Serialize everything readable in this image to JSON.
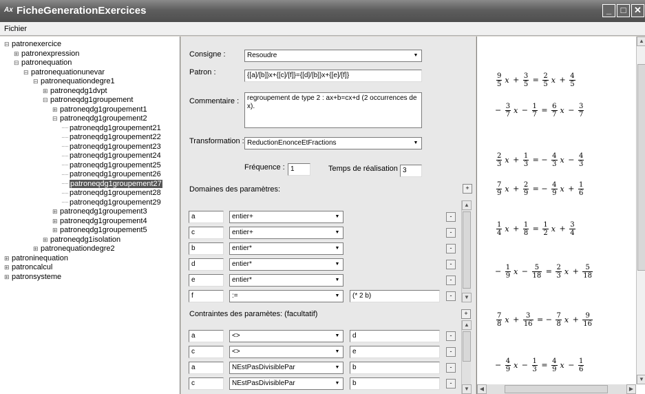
{
  "window": {
    "title": "FicheGenerationExercices",
    "icon": "app-icon",
    "buttons": [
      "minimize-icon",
      "maximize-icon",
      "close-icon"
    ]
  },
  "menu": [
    "Fichier"
  ],
  "tree": [
    {
      "label": "patronexercice",
      "level": 0,
      "exp": "minus"
    },
    {
      "label": "patronexpression",
      "level": 1,
      "exp": "plus"
    },
    {
      "label": "patronequation",
      "level": 1,
      "exp": "minus"
    },
    {
      "label": "patronequationunevar",
      "level": 2,
      "exp": "minus"
    },
    {
      "label": "patronequationdegre1",
      "level": 3,
      "exp": "minus"
    },
    {
      "label": "patroneqdg1dvpt",
      "level": 4,
      "exp": "plus"
    },
    {
      "label": "patroneqdg1groupement",
      "level": 4,
      "exp": "minus"
    },
    {
      "label": "patroneqdg1groupement1",
      "level": 5,
      "exp": "plus"
    },
    {
      "label": "patroneqdg1groupement2",
      "level": 5,
      "exp": "minus"
    },
    {
      "label": "patroneqdg1groupement21",
      "level": 6,
      "exp": "leaf"
    },
    {
      "label": "patroneqdg1groupement22",
      "level": 6,
      "exp": "leaf"
    },
    {
      "label": "patroneqdg1groupement23",
      "level": 6,
      "exp": "leaf"
    },
    {
      "label": "patroneqdg1groupement24",
      "level": 6,
      "exp": "leaf"
    },
    {
      "label": "patroneqdg1groupement25",
      "level": 6,
      "exp": "leaf"
    },
    {
      "label": "patroneqdg1groupement26",
      "level": 6,
      "exp": "leaf"
    },
    {
      "label": "patroneqdg1groupement27",
      "level": 6,
      "exp": "leaf",
      "selected": true
    },
    {
      "label": "patroneqdg1groupement28",
      "level": 6,
      "exp": "leaf"
    },
    {
      "label": "patroneqdg1groupement29",
      "level": 6,
      "exp": "leaf"
    },
    {
      "label": "patroneqdg1groupement3",
      "level": 5,
      "exp": "plus"
    },
    {
      "label": "patroneqdg1groupement4",
      "level": 5,
      "exp": "plus"
    },
    {
      "label": "patroneqdg1groupement5",
      "level": 5,
      "exp": "plus"
    },
    {
      "label": "patroneqdg1isolation",
      "level": 4,
      "exp": "plus"
    },
    {
      "label": "patronequationdegre2",
      "level": 3,
      "exp": "plus"
    },
    {
      "label": "patroninequation",
      "level": 0,
      "exp": "plus"
    },
    {
      "label": "patroncalcul",
      "level": 0,
      "exp": "plus"
    },
    {
      "label": "patronsysteme",
      "level": 0,
      "exp": "plus"
    }
  ],
  "form": {
    "consigne_label": "Consigne :",
    "consigne_value": "Resoudre",
    "patron_label": "Patron :",
    "patron_value": "{[a]/[b]}x+{[c]/[f]}={[d]/[b]}x+{[e]/[f]}",
    "commentaire_label": "Commentaire :",
    "commentaire_value": "regroupement de type 2 : ax+b=cx+d (2 occurrences de x).",
    "transformation_label": "Transformation :",
    "transformation_value": "ReductionEnonceEtFractions",
    "frequence_label": "Fréquence :",
    "frequence_value": "1",
    "temps_label": "Temps de réalisation :",
    "temps_value": "3",
    "domaines_label": "Domaines des paramètres:",
    "contraintes_label": "Contraintes des paramètes: (facultatif)",
    "add_glyph": "+",
    "remove_glyph": "-",
    "domaines": [
      {
        "name": "a",
        "type": "entier+",
        "expr": ""
      },
      {
        "name": "c",
        "type": "entier+",
        "expr": ""
      },
      {
        "name": "b",
        "type": "entier*",
        "expr": ""
      },
      {
        "name": "d",
        "type": "entier*",
        "expr": ""
      },
      {
        "name": "e",
        "type": "entier*",
        "expr": ""
      },
      {
        "name": "f",
        "type": ":=",
        "expr": "(* 2 b)"
      }
    ],
    "contraintes": [
      {
        "left": "a",
        "op": "<>",
        "right": "d"
      },
      {
        "left": "c",
        "op": "<>",
        "right": "e"
      },
      {
        "left": "a",
        "op": "NEstPasDivisiblePar",
        "right": "b"
      },
      {
        "left": "c",
        "op": "NEstPasDivisiblePar",
        "right": "b"
      }
    ]
  },
  "equations": [
    {
      "html": "<F>9|5</F><i>x</i> + <F>3|5</F> = <F>2|5</F><i>x</i> + <F>4|5</F>"
    },
    {
      "html": "− <F>3|7</F><i>x</i> − <F>1|7</F> = <F>6|7</F><i>x</i> − <F>3|7</F>"
    },
    {
      "html": "<F>2|3</F><i>x</i> + <F>1|3</F> = − <F>4|3</F><i>x</i> − <F>4|3</F>"
    },
    {
      "html": "<F>7|9</F><i>x</i> + <F>2|9</F> = − <F>4|9</F><i>x</i> + <F>1|6</F>"
    },
    {
      "html": "<F>1|4</F><i>x</i> + <F>1|8</F> = <F>1|2</F><i>x</i> + <F>3|4</F>"
    },
    {
      "html": "− <F>1|9</F><i>x</i> − <F>5|18</F> = <F>2|3</F><i>x</i> + <F>5|18</F>"
    },
    {
      "html": "<F>7|8</F><i>x</i> + <F>3|16</F> = − <F>7|8</F><i>x</i> + <F>9|16</F>"
    },
    {
      "html": "− <F>4|9</F><i>x</i> − <F>1|3</F> = <F>4|9</F><i>x</i> − <F>1|6</F>"
    }
  ]
}
